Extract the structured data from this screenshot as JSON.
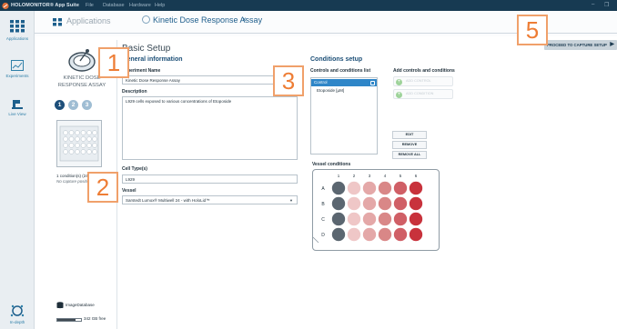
{
  "titlebar": {
    "brand": "HOLOMONITOR® App Suite",
    "menus": [
      "File",
      "Database",
      "Hardware",
      "Help"
    ],
    "minimize": "–",
    "restore": "❐"
  },
  "sidebar": {
    "applications": "Applications",
    "experiments": "Experiments",
    "live_view": "Live View",
    "in_depth": "In-depth"
  },
  "tabs": {
    "applications": "Applications",
    "active": "Kinetic Dose Response Assay",
    "close": "×"
  },
  "proceed_button": "PROCEED TO CAPTURE SETUP",
  "assay": {
    "title_line1": "KINETIC DOSE",
    "title_line2": "RESPONSE ASSAY",
    "steps": [
      "1",
      "2",
      "3"
    ],
    "conditions_summary": "1 condition(s) (24 wells)",
    "capture_positions": "No capture positions"
  },
  "database": {
    "label": "ImageDatabase",
    "free": "342 GB free",
    "used_fraction": 0.75
  },
  "basic_setup": {
    "title": "Basic Setup",
    "general_title": "General information",
    "experiment_name_label": "Experiment Name",
    "experiment_name": "Kinetic Dose Response Assay",
    "description_label": "Description",
    "description": "L929 cells exposed to various concentrations of Etoposide",
    "cell_type_label": "Cell Type(s)",
    "cell_type": "L929",
    "vessel_label": "Vessel",
    "vessel": "Sarstedt Lumox® Multiwell 24 - with HoloLid™"
  },
  "conditions": {
    "title": "Conditions setup",
    "list_label": "Controls and conditions list",
    "items": [
      "Control",
      "Etoposide [µM]"
    ],
    "add_label": "Add controls and conditions",
    "add_control": "ADD CONTROL",
    "add_condition": "ADD CONDITION",
    "edit": "EDIT",
    "remove": "REMOVE",
    "remove_all": "REMOVE ALL"
  },
  "vessel_conditions": {
    "title": "Vessel conditions",
    "columns": [
      "1",
      "2",
      "3",
      "4",
      "5",
      "6"
    ],
    "rows": [
      "A",
      "B",
      "C",
      "D"
    ],
    "colors": {
      "control": "#5b6670",
      "c1": "#efc7c7",
      "c2": "#e4a8a8",
      "c3": "#d98787",
      "c4": "#d05f66",
      "c5": "#c8323c"
    }
  },
  "annotations": [
    "1",
    "2",
    "3",
    "5"
  ]
}
